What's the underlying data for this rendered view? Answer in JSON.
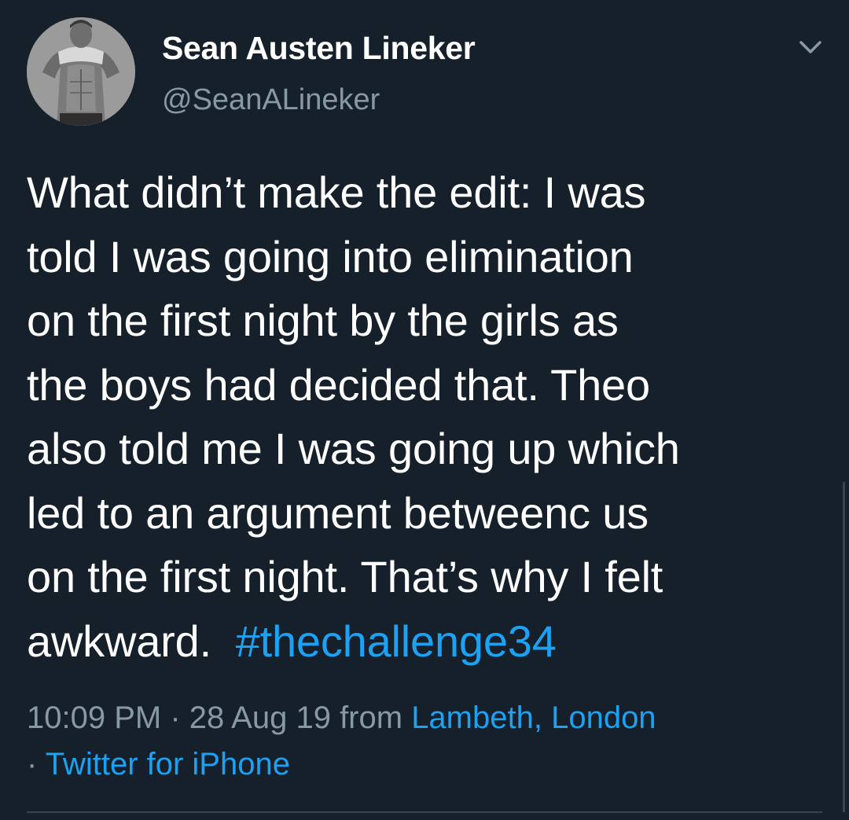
{
  "user": {
    "display_name": "Sean Austen Lineker",
    "handle": "@SeanALineker",
    "avatar_icon": "profile-photo"
  },
  "tweet": {
    "lines": [
      "What didn’t make the edit: I was",
      "told I was going into elimination",
      "on the first night by the girls as",
      "the boys had decided that. Theo",
      "also told me I was going up which",
      "led to an argument betweenc us",
      "on the first night. That’s why I felt"
    ],
    "last_line_text": "awkward.  ",
    "hashtag": "#thechallenge34"
  },
  "meta": {
    "time": "10:09 PM",
    "separator": " · ",
    "date": "28 Aug 19",
    "from_label": " from ",
    "location": "Lambeth, London",
    "separator2": "· ",
    "source": "Twitter for iPhone"
  },
  "icons": {
    "menu": "chevron-down-icon"
  },
  "colors": {
    "background": "#15202b",
    "text": "#ffffff",
    "secondary": "#8899a6",
    "link": "#1da1f2",
    "divider": "#38444d"
  }
}
